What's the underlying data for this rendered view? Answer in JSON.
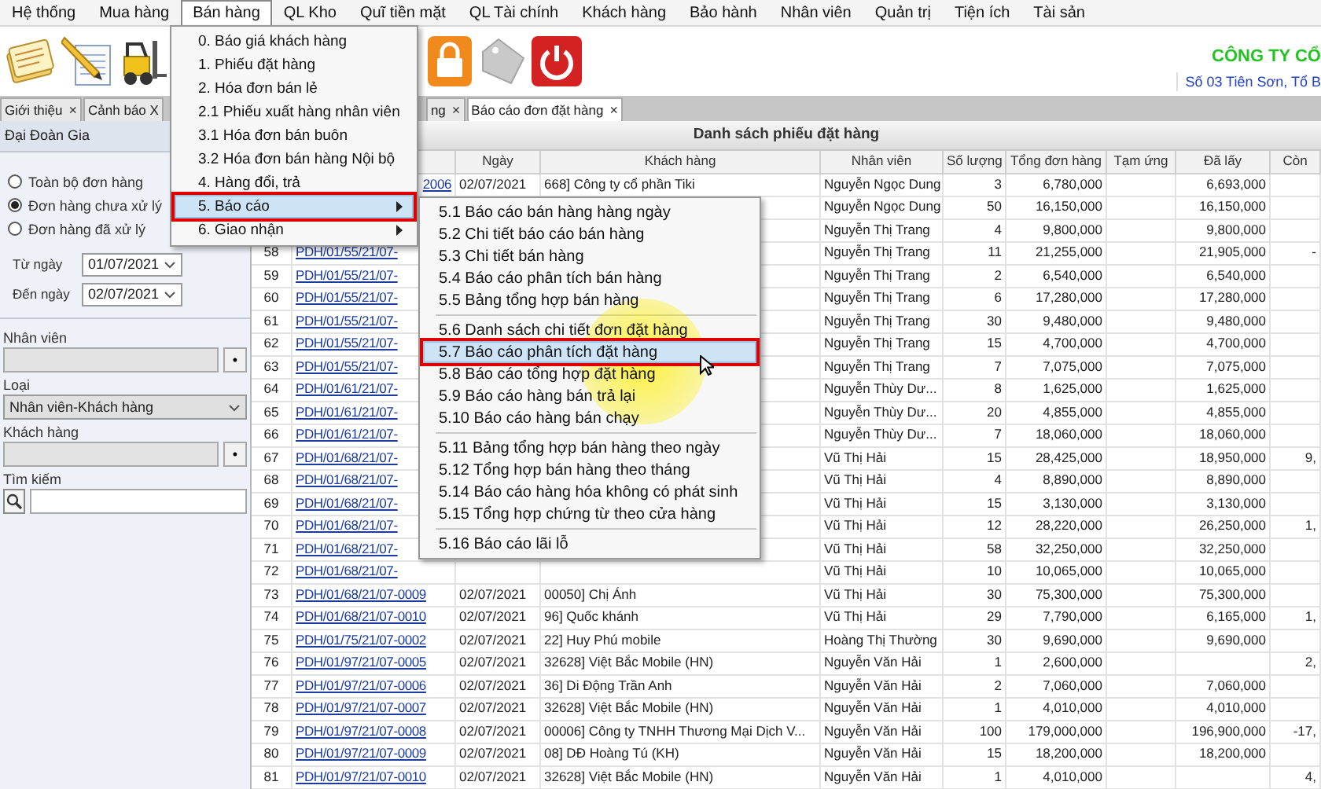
{
  "menu_bar": [
    {
      "label": "Hệ thống",
      "selected": false
    },
    {
      "label": "Mua hàng",
      "selected": false
    },
    {
      "label": "Bán hàng",
      "selected": true
    },
    {
      "label": "QL Kho",
      "selected": false
    },
    {
      "label": "Quĩ tiền mặt",
      "selected": false
    },
    {
      "label": "QL Tài chính",
      "selected": false
    },
    {
      "label": "Khách hàng",
      "selected": false
    },
    {
      "label": "Bảo hành",
      "selected": false
    },
    {
      "label": "Nhân viên",
      "selected": false
    },
    {
      "label": "Quản trị",
      "selected": false
    },
    {
      "label": "Tiện ích",
      "selected": false
    },
    {
      "label": "Tài sản",
      "selected": false
    }
  ],
  "toolbar": {
    "company_name": "CÔNG TY CỔ",
    "company_address": "Số 03 Tiên Sơn, Tổ B"
  },
  "tabs": [
    {
      "label": "Giới thiệu",
      "close": "×",
      "selected": false
    },
    {
      "label": "Cảnh báo X",
      "selected": false
    },
    {
      "label": "ng",
      "close": "×",
      "selected": false
    },
    {
      "label": "Báo cáo đơn đặt hàng",
      "close": "×",
      "selected": true
    }
  ],
  "filter_panel": {
    "title": "Đại Đoàn Gia",
    "radios": [
      {
        "label": "Toàn bộ đơn hàng",
        "selected": false
      },
      {
        "label": "Đơn hàng chưa xử lý",
        "selected": true
      },
      {
        "label": "Đơn hàng đã xử lý",
        "selected": false
      }
    ],
    "date_fields": [
      {
        "label": "Từ ngày",
        "value": "01/07/2021"
      },
      {
        "label": "Đến ngày",
        "value": "02/07/2021"
      }
    ],
    "employee": {
      "label": "Nhân viên",
      "button": "•"
    },
    "type": {
      "label": "Loại",
      "value": "Nhân viên-Khách hàng"
    },
    "customer": {
      "label": "Khách hàng",
      "button": "•"
    },
    "search": {
      "label": "Tìm kiếm"
    }
  },
  "table": {
    "title": "Danh sách phiếu đặt hàng",
    "columns": [
      "Ngày",
      "Khách hàng",
      "Nhân viên",
      "Số lượng",
      "Tổng đơn hàng",
      "Tạm ứng",
      "Đã lấy",
      "Còn"
    ],
    "rows": [
      {
        "code": "2006",
        "date": "02/07/2021",
        "customer": "668] Công ty cổ phần Tiki",
        "employee": "Nguyễn Ngọc Dung",
        "quantity": "3",
        "total": "6,780,000",
        "taken": "6,693,000"
      },
      {
        "employee": "Nguyễn Ngọc Dung",
        "quantity": "50",
        "total": "16,150,000",
        "taken": "16,150,000"
      },
      {
        "employee": "Nguyễn Thị Trang",
        "quantity": "4",
        "total": "9,800,000",
        "taken": "9,800,000"
      },
      {
        "number": "58",
        "code": "PDH/01/55/21/07-",
        "employee": "Nguyễn Thị Trang",
        "quantity": "11",
        "total": "21,255,000",
        "taken": "21,905,000",
        "remaining": "-"
      },
      {
        "number": "59",
        "code": "PDH/01/55/21/07-",
        "employee": "Nguyễn Thị Trang",
        "quantity": "2",
        "total": "6,540,000",
        "taken": "6,540,000"
      },
      {
        "number": "60",
        "code": "PDH/01/55/21/07-",
        "employee": "Nguyễn Thị Trang",
        "quantity": "6",
        "total": "17,280,000",
        "taken": "17,280,000"
      },
      {
        "number": "61",
        "code": "PDH/01/55/21/07-",
        "employee": "Nguyễn Thị Trang",
        "quantity": "30",
        "total": "9,480,000",
        "taken": "9,480,000"
      },
      {
        "number": "62",
        "code": "PDH/01/55/21/07-",
        "employee": "Nguyễn Thị Trang",
        "quantity": "15",
        "total": "4,700,000",
        "taken": "4,700,000"
      },
      {
        "number": "63",
        "code": "PDH/01/55/21/07-",
        "employee": "Nguyễn Thị Trang",
        "quantity": "7",
        "total": "7,075,000",
        "taken": "7,075,000"
      },
      {
        "number": "64",
        "code": "PDH/01/61/21/07-",
        "employee": "Nguyễn Thùy Dư...",
        "quantity": "8",
        "total": "1,625,000",
        "taken": "1,625,000"
      },
      {
        "number": "65",
        "code": "PDH/01/61/21/07-",
        "employee": "Nguyễn Thùy Dư...",
        "quantity": "20",
        "total": "4,855,000",
        "taken": "4,855,000"
      },
      {
        "number": "66",
        "code": "PDH/01/61/21/07-",
        "employee": "Nguyễn Thùy Dư...",
        "quantity": "7",
        "total": "18,060,000",
        "taken": "18,060,000"
      },
      {
        "number": "67",
        "code": "PDH/01/68/21/07-",
        "employee": "Vũ Thị Hải",
        "quantity": "15",
        "total": "28,425,000",
        "taken": "18,950,000",
        "remaining": "9,"
      },
      {
        "number": "68",
        "code": "PDH/01/68/21/07-",
        "employee": "Vũ Thị Hải",
        "quantity": "4",
        "total": "8,890,000",
        "taken": "8,890,000"
      },
      {
        "number": "69",
        "code": "PDH/01/68/21/07-",
        "employee": "Vũ Thị Hải",
        "quantity": "15",
        "total": "3,130,000",
        "taken": "3,130,000"
      },
      {
        "number": "70",
        "code": "PDH/01/68/21/07-",
        "employee": "Vũ Thị Hải",
        "quantity": "12",
        "total": "28,220,000",
        "taken": "26,250,000",
        "remaining": "1,"
      },
      {
        "number": "71",
        "code": "PDH/01/68/21/07-",
        "employee": "Vũ Thị Hải",
        "quantity": "58",
        "total": "32,250,000",
        "taken": "32,250,000"
      },
      {
        "number": "72",
        "code": "PDH/01/68/21/07-",
        "employee": "Vũ Thị Hải",
        "quantity": "10",
        "total": "10,065,000",
        "taken": "10,065,000"
      },
      {
        "number": "73",
        "code": "PDH/01/68/21/07-0009",
        "date": "02/07/2021",
        "customer": "00050] Chị Ánh",
        "employee": "Vũ Thị Hải",
        "quantity": "30",
        "total": "75,300,000",
        "taken": "75,300,000"
      },
      {
        "number": "74",
        "code": "PDH/01/68/21/07-0010",
        "date": "02/07/2021",
        "customer": "96] Quốc khánh",
        "employee": "Vũ Thị Hải",
        "quantity": "29",
        "total": "7,790,000",
        "taken": "6,165,000",
        "remaining": "1,"
      },
      {
        "number": "75",
        "code": "PDH/01/75/21/07-0002",
        "date": "02/07/2021",
        "customer": "22] Huy Phú mobile",
        "employee": "Hoàng Thị Thường",
        "quantity": "30",
        "total": "9,690,000",
        "taken": "9,690,000"
      },
      {
        "number": "76",
        "code": "PDH/01/97/21/07-0005",
        "date": "02/07/2021",
        "customer": "32628] Việt Bắc Mobile (HN)",
        "employee": "Nguyễn Văn Hải",
        "quantity": "1",
        "total": "2,600,000",
        "remaining": "2,"
      },
      {
        "number": "77",
        "code": "PDH/01/97/21/07-0006",
        "date": "02/07/2021",
        "customer": "36] Di Động Trần Anh",
        "employee": "Nguyễn Văn Hải",
        "quantity": "2",
        "total": "7,060,000",
        "taken": "7,060,000"
      },
      {
        "number": "78",
        "code": "PDH/01/97/21/07-0007",
        "date": "02/07/2021",
        "customer": "32628] Việt Bắc Mobile (HN)",
        "employee": "Nguyễn Văn Hải",
        "quantity": "1",
        "total": "4,010,000",
        "taken": "4,010,000"
      },
      {
        "number": "79",
        "code": "PDH/01/97/21/07-0008",
        "date": "02/07/2021",
        "customer": "00006] Công ty TNHH Thương Mại Dịch V...",
        "employee": "Nguyễn Văn Hải",
        "quantity": "100",
        "total": "179,000,000",
        "taken": "196,900,000",
        "remaining": "-17,"
      },
      {
        "number": "80",
        "code": "PDH/01/97/21/07-0009",
        "date": "02/07/2021",
        "customer": "08] DĐ Hoàng Tú (KH)",
        "employee": "Nguyễn Văn Hải",
        "quantity": "15",
        "total": "18,200,000",
        "taken": "18,200,000"
      },
      {
        "number": "81",
        "code": "PDH/01/97/21/07-0010",
        "date": "02/07/2021",
        "customer": "32628] Việt Bắc Mobile (HN)",
        "employee": "Nguyễn Văn Hải",
        "quantity": "1",
        "total": "4,010,000",
        "remaining": "4,"
      }
    ]
  },
  "menu": {
    "items": [
      {
        "label": "0. Báo giá khách hàng",
        "selected": false,
        "has_submenu": false
      },
      {
        "label": "1. Phiếu đặt hàng",
        "selected": false,
        "has_submenu": false
      },
      {
        "label": "2. Hóa đơn bán lẻ",
        "selected": false,
        "has_submenu": false
      },
      {
        "label": "2.1 Phiếu xuất hàng nhân viên",
        "selected": false,
        "has_submenu": false
      },
      {
        "label": "3.1 Hóa đơn bán buôn",
        "selected": false,
        "has_submenu": false
      },
      {
        "label": "3.2 Hóa đơn bán hàng Nội bộ",
        "selected": false,
        "has_submenu": false
      },
      {
        "label": "4. Hàng đổi, trả",
        "selected": false,
        "has_submenu": false
      },
      {
        "label": "5. Báo cáo",
        "selected": true,
        "has_submenu": true
      },
      {
        "label": "6. Giao nhận",
        "selected": false,
        "has_submenu": true
      }
    ]
  },
  "submenu": {
    "items": [
      {
        "kind": "item",
        "label": "5.1 Báo cáo bán hàng hàng ngày",
        "selected": false
      },
      {
        "kind": "item",
        "label": "5.2 Chi tiết báo cáo bán hàng",
        "selected": false
      },
      {
        "kind": "item",
        "label": "5.3 Chi tiết bán hàng",
        "selected": false
      },
      {
        "kind": "item",
        "label": "5.4 Báo cáo phân tích bán hàng",
        "selected": false
      },
      {
        "kind": "item",
        "label": "5.5 Bảng tổng hợp bán hàng",
        "selected": false
      },
      {
        "kind": "separator"
      },
      {
        "kind": "item",
        "label": "5.6 Danh sách chi tiết đơn đặt hàng",
        "selected": false
      },
      {
        "kind": "item",
        "label": "5.7 Báo cáo phân tích đặt hàng",
        "selected": true
      },
      {
        "kind": "item",
        "label": "5.8 Báo cáo tổng hợp đặt hàng",
        "selected": false
      },
      {
        "kind": "item",
        "label": "5.9 Báo cáo hàng bán trả lại",
        "selected": false
      },
      {
        "kind": "item",
        "label": "5.10 Báo cáo hàng bán chạy",
        "selected": false
      },
      {
        "kind": "separator"
      },
      {
        "kind": "item",
        "label": "5.11 Bảng tổng hợp bán hàng theo ngày",
        "selected": false
      },
      {
        "kind": "item",
        "label": "5.12 Tổng hợp bán hàng theo tháng",
        "selected": false
      },
      {
        "kind": "item",
        "label": "5.14 Báo cáo hàng hóa không có phát sinh",
        "selected": false
      },
      {
        "kind": "item",
        "label": "5.15 Tổng hợp chứng từ theo cửa hàng",
        "selected": false
      },
      {
        "kind": "separator"
      },
      {
        "kind": "item",
        "label": "5.16 Báo cáo lãi lỗ",
        "selected": false
      }
    ]
  }
}
